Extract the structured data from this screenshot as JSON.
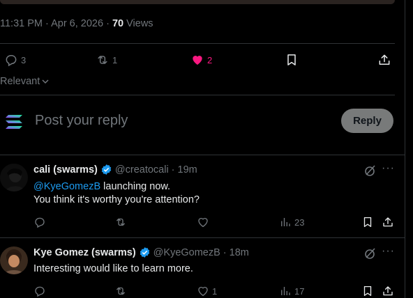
{
  "tweet": {
    "time": "11:31 PM",
    "date": "Apr 6, 2026",
    "views_count": "70",
    "views_label": "Views",
    "replies_count": "3",
    "reposts_count": "1",
    "likes_count": "2",
    "liked": true
  },
  "sort": {
    "label": "Relevant"
  },
  "composer": {
    "placeholder": "Post your reply",
    "reply_label": "Reply"
  },
  "replies": [
    {
      "name": "cali (swarms)",
      "handle": "@creatocali",
      "age": "19m",
      "mention": "@KyeGomezB",
      "text_after_mention": " launching now.",
      "line2": "You think it's worthy you're attention?",
      "views": "23",
      "likes": ""
    },
    {
      "name": "Kye Gomez (swarms)",
      "handle": "@KyeGomezB",
      "age": "18m",
      "line1": "Interesting would like to learn more.",
      "views": "17",
      "likes": "1"
    }
  ],
  "colors": {
    "accent": "#1d9bf0",
    "like": "#f91880",
    "muted": "#71767b"
  }
}
